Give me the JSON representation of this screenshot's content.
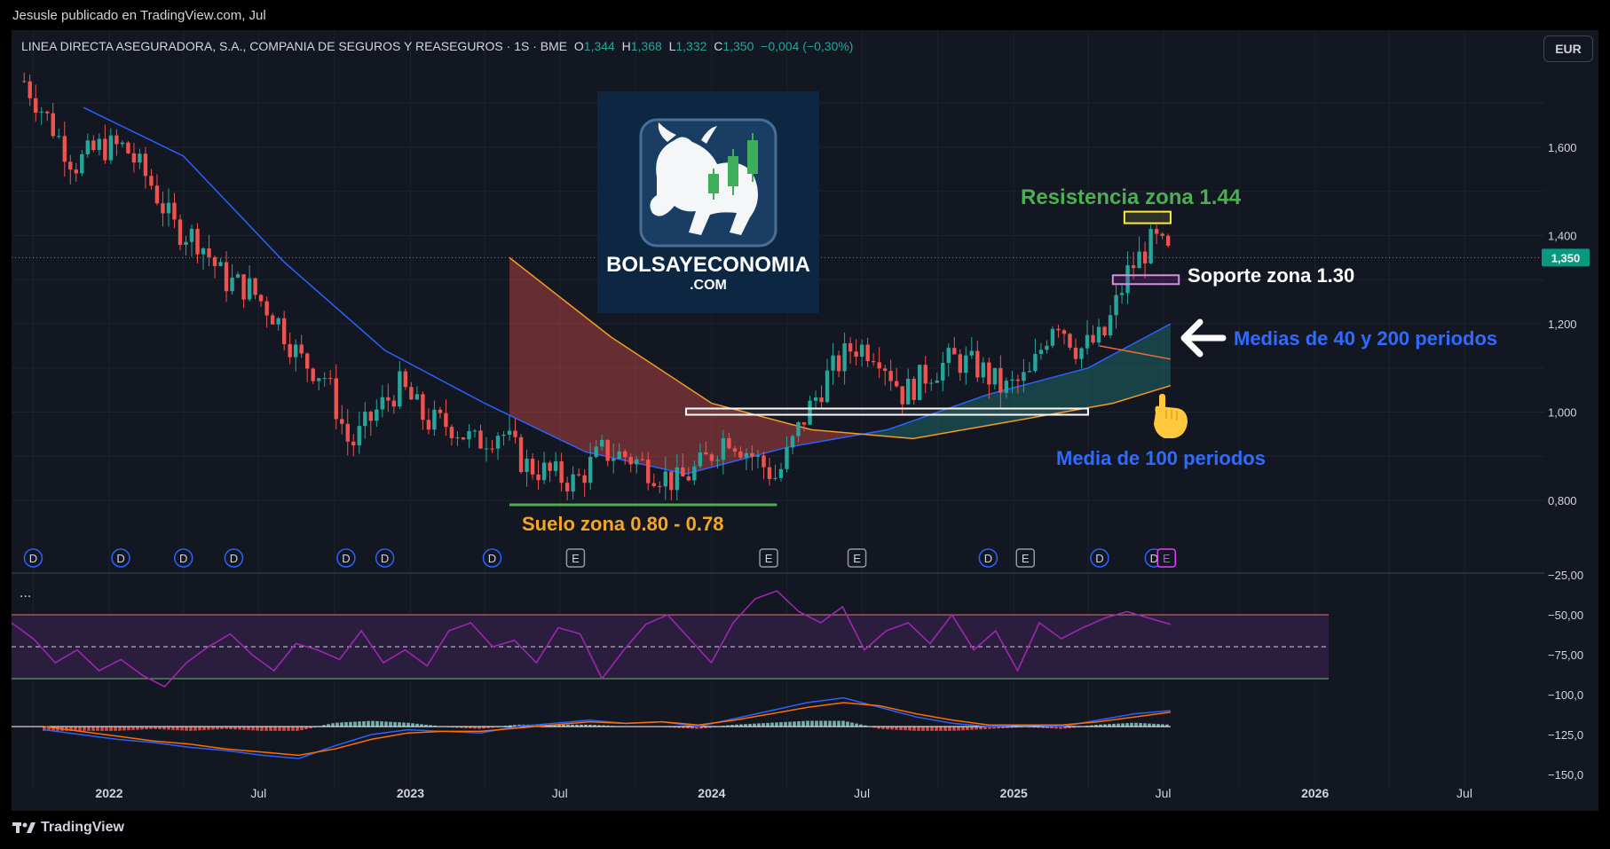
{
  "header": {
    "publisher": "Jesusle publicado en TradingView.com, Jul"
  },
  "legend": {
    "title": "LINEA DIRECTA ASEGURADORA, S.A., COMPANIA DE SEGUROS Y REASEGUROS · 1S · BME",
    "o_label": "O",
    "o_value": "1,344",
    "h_label": "H",
    "h_value": "1,368",
    "l_label": "L",
    "l_value": "1,332",
    "c_label": "C",
    "c_value": "1,350",
    "change": "−0,004 (−0,30%)"
  },
  "currency_button": "EUR",
  "indicator_menu": "...",
  "branding": {
    "tv_name": "TradingView",
    "logo_word1": "BOLSAYECONOMIA",
    "logo_word2": ".COM"
  },
  "annotations": {
    "resistance": "Resistencia zona 1.44",
    "support": "Soporte zona 1.30",
    "medias": "Medias de 40 y 200 periodos",
    "media100": "Media de 100 periodos",
    "suelo": "Suelo zona 0.80 - 0.78"
  },
  "colors": {
    "up": "#26a69a",
    "down": "#ef5350",
    "ma40": "#2962ff",
    "ma100": "#f59a23",
    "ma200": "#f06a3a",
    "rsi": "#9c27b0",
    "rsi_band": "#2b1d3d",
    "macd": "#2962ff",
    "signal": "#ff6d00",
    "green_text": "#4caf50",
    "orange_text": "#f5a623",
    "blue_text": "#2f6bff"
  },
  "chart_data": {
    "type": "candlestick",
    "timeframe": "1S",
    "y_ticks": [
      "1,600",
      "1,400",
      "1,200",
      "1,000",
      "0,800"
    ],
    "y_tick_values": [
      1.6,
      1.4,
      1.2,
      1.0,
      0.8
    ],
    "ylim": [
      0.72,
      1.78
    ],
    "current_price": "1,350",
    "current_price_value": 1.35,
    "x_ticks": [
      "2022",
      "Jul",
      "2023",
      "Jul",
      "2024",
      "Jul",
      "2025",
      "Jul",
      "2026",
      "Jul"
    ],
    "x_tick_dates": [
      "2022-01-01",
      "2022-07-01",
      "2023-01-01",
      "2023-07-01",
      "2024-01-01",
      "2024-07-01",
      "2025-01-01",
      "2025-07-01",
      "2026-01-01",
      "2026-07-01"
    ],
    "price_path": [
      [
        "2021-09-20",
        1.75
      ],
      [
        "2021-10-20",
        1.66
      ],
      [
        "2021-11-20",
        1.56
      ],
      [
        "2021-12-20",
        1.6
      ],
      [
        "2022-01-20",
        1.6
      ],
      [
        "2022-02-20",
        1.52
      ],
      [
        "2022-03-20",
        1.42
      ],
      [
        "2022-04-20",
        1.39
      ],
      [
        "2022-05-20",
        1.3
      ],
      [
        "2022-06-20",
        1.28
      ],
      [
        "2022-07-20",
        1.22
      ],
      [
        "2022-08-20",
        1.12
      ],
      [
        "2022-09-20",
        1.08
      ],
      [
        "2022-10-20",
        0.92
      ],
      [
        "2022-11-20",
        1.0
      ],
      [
        "2022-12-20",
        1.06
      ],
      [
        "2023-01-20",
        0.98
      ],
      [
        "2023-02-20",
        0.97
      ],
      [
        "2023-03-20",
        0.93
      ],
      [
        "2023-04-20",
        0.96
      ],
      [
        "2023-05-20",
        0.88
      ],
      [
        "2023-06-20",
        0.86
      ],
      [
        "2023-07-20",
        0.84
      ],
      [
        "2023-08-20",
        0.91
      ],
      [
        "2023-09-20",
        0.9
      ],
      [
        "2023-10-20",
        0.87
      ],
      [
        "2023-11-20",
        0.84
      ],
      [
        "2023-12-20",
        0.88
      ],
      [
        "2024-01-20",
        0.95
      ],
      [
        "2024-02-20",
        0.9
      ],
      [
        "2024-03-20",
        0.85
      ],
      [
        "2024-04-20",
        0.98
      ],
      [
        "2024-05-20",
        1.08
      ],
      [
        "2024-06-20",
        1.15
      ],
      [
        "2024-07-20",
        1.14
      ],
      [
        "2024-08-20",
        1.04
      ],
      [
        "2024-09-20",
        1.09
      ],
      [
        "2024-10-20",
        1.12
      ],
      [
        "2024-11-20",
        1.1
      ],
      [
        "2024-12-20",
        1.05
      ],
      [
        "2025-01-20",
        1.08
      ],
      [
        "2025-02-20",
        1.22
      ],
      [
        "2025-03-20",
        1.14
      ],
      [
        "2025-04-20",
        1.17
      ],
      [
        "2025-05-20",
        1.32
      ],
      [
        "2025-06-20",
        1.39
      ],
      [
        "2025-07-10",
        1.35
      ]
    ],
    "moving_averages": [
      {
        "period": 40,
        "points": [
          [
            "2021-12-01",
            1.69
          ],
          [
            "2022-04-01",
            1.58
          ],
          [
            "2022-08-01",
            1.34
          ],
          [
            "2022-12-01",
            1.14
          ],
          [
            "2023-04-01",
            1.02
          ],
          [
            "2023-08-01",
            0.91
          ],
          [
            "2023-12-01",
            0.86
          ],
          [
            "2024-04-01",
            0.92
          ],
          [
            "2024-08-01",
            0.96
          ],
          [
            "2024-12-01",
            1.04
          ],
          [
            "2025-04-01",
            1.1
          ],
          [
            "2025-07-10",
            1.2
          ]
        ]
      },
      {
        "period": 100,
        "points": [
          [
            "2023-05-01",
            1.35
          ],
          [
            "2023-09-01",
            1.17
          ],
          [
            "2024-01-01",
            1.02
          ],
          [
            "2024-05-01",
            0.96
          ],
          [
            "2024-09-01",
            0.94
          ],
          [
            "2025-01-01",
            0.98
          ],
          [
            "2025-05-01",
            1.02
          ],
          [
            "2025-07-10",
            1.06
          ]
        ]
      },
      {
        "period": 200,
        "points": [
          [
            "2025-04-15",
            1.15
          ],
          [
            "2025-07-10",
            1.12
          ]
        ]
      }
    ],
    "zones": [
      {
        "name": "resistance",
        "level": 1.44,
        "from": "2025-05-15",
        "to": "2025-07-10"
      },
      {
        "name": "support",
        "level": 1.3,
        "from": "2025-05-01",
        "to": "2025-07-20"
      },
      {
        "name": "breakout",
        "level": 1.0,
        "from": "2023-12-01",
        "to": "2025-04-01"
      },
      {
        "name": "floor",
        "level": 0.79,
        "from": "2023-05-01",
        "to": "2024-03-20"
      }
    ],
    "event_markers": [
      {
        "type": "D",
        "date": "2021-10-01"
      },
      {
        "type": "D",
        "date": "2022-01-15"
      },
      {
        "type": "D",
        "date": "2022-04-01"
      },
      {
        "type": "D",
        "date": "2022-06-01"
      },
      {
        "type": "D",
        "date": "2022-10-15"
      },
      {
        "type": "D",
        "date": "2022-12-01"
      },
      {
        "type": "D",
        "date": "2023-04-10"
      },
      {
        "type": "E",
        "date": "2023-07-20"
      },
      {
        "type": "E",
        "date": "2024-03-10"
      },
      {
        "type": "E",
        "date": "2024-06-25"
      },
      {
        "type": "D",
        "date": "2024-12-01"
      },
      {
        "type": "E",
        "date": "2025-01-15"
      },
      {
        "type": "D",
        "date": "2025-04-15"
      },
      {
        "type": "D",
        "date": "2025-06-20"
      },
      {
        "type": "E",
        "date": "2025-07-05"
      }
    ],
    "indicator_scale": {
      "ticks": [
        "−25,00",
        "−50,00",
        "−75,00",
        "−100,0",
        "−125,0",
        "−150,0"
      ],
      "values": [
        -25,
        -50,
        -75,
        -100,
        -125,
        -150
      ]
    },
    "rsi": {
      "band": [
        -50,
        -90
      ],
      "midline": -70,
      "points": [
        -55,
        -65,
        -80,
        -72,
        -85,
        -78,
        -88,
        -95,
        -80,
        -70,
        -62,
        -75,
        -85,
        -68,
        -72,
        -78,
        -60,
        -80,
        -72,
        -82,
        -60,
        -55,
        -70,
        -66,
        -80,
        -58,
        -62,
        -90,
        -72,
        -56,
        -50,
        -65,
        -80,
        -55,
        -40,
        -35,
        -48,
        -55,
        -45,
        -72,
        -60,
        -55,
        -68,
        -50,
        -72,
        -60,
        -85,
        -55,
        -65,
        -58,
        -52,
        -48,
        -52,
        -56
      ]
    },
    "macd": {
      "zero": -120,
      "macd_points": [
        -122,
        -125,
        -128,
        -130,
        -133,
        -135,
        -138,
        -140,
        -132,
        -125,
        -122,
        -123,
        -124,
        -120,
        -118,
        -116,
        -118,
        -117,
        -120,
        -115,
        -110,
        -105,
        -102,
        -108,
        -114,
        -118,
        -120,
        -119,
        -120,
        -116,
        -112,
        -110
      ],
      "signal_points": [
        -120,
        -123,
        -126,
        -129,
        -131,
        -134,
        -136,
        -138,
        -134,
        -128,
        -124,
        -123,
        -123,
        -121,
        -119,
        -117,
        -118,
        -117,
        -119,
        -116,
        -112,
        -108,
        -105,
        -107,
        -112,
        -116,
        -119,
        -119,
        -119,
        -117,
        -114,
        -111
      ]
    }
  }
}
